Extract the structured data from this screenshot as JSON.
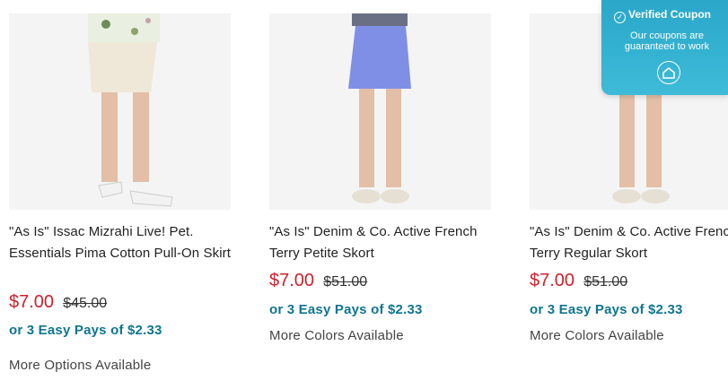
{
  "products": [
    {
      "title": "\"As Is\" Issac Mizrahi Live! Pet. Essentials Pima Cotton Pull-On Skirt",
      "price": "$7.00",
      "was_price": "$45.00",
      "easy_pay": "or 3 Easy Pays of $2.33",
      "more": "More Options Available",
      "image_icon": "skirt-cream-photo"
    },
    {
      "title": "\"As Is\" Denim & Co. Active French Terry Petite Skort",
      "price": "$7.00",
      "was_price": "$51.00",
      "easy_pay": "or 3 Easy Pays of $2.33",
      "more": "More Colors Available",
      "image_icon": "skort-blue-photo"
    },
    {
      "title": "\"As Is\" Denim & Co. Active French Terry Regular Skort",
      "price": "$7.00",
      "was_price": "$51.00",
      "easy_pay": "or 3 Easy Pays of $2.33",
      "more": "More Colors Available",
      "image_icon": "skort-blue-photo"
    }
  ],
  "coupon": {
    "title": "Verified Coupon",
    "message": "Our coupons are guaranteed to work",
    "icon": "home-shield-icon"
  },
  "colors": {
    "price": "#d0202c",
    "easy_pay": "#0f7590",
    "coupon_bg": "#2aa7c9",
    "skirt_cream": "#efe8d8",
    "skort_blue": "#7f8fe6"
  }
}
